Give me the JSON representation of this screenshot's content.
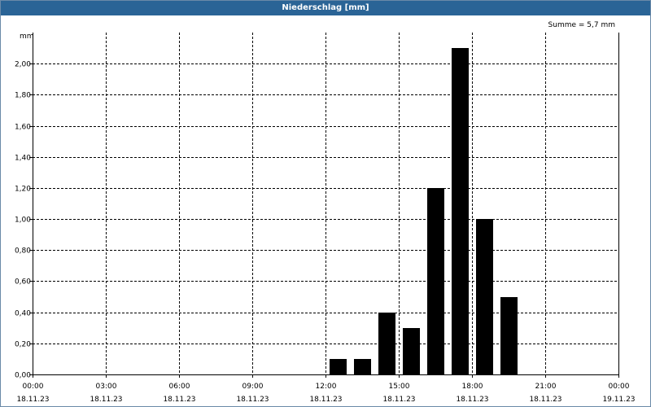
{
  "window": {
    "title": "Niederschlag [mm]",
    "sum_label": "Summe = 5,7 mm"
  },
  "chart_data": {
    "type": "bar",
    "title": "Niederschlag [mm]",
    "ylabel": "mm",
    "annotation": "Summe = 5,7 mm",
    "ylim": [
      0,
      2.2
    ],
    "y_ticks": [
      {
        "value": 0.0,
        "label": "0,00"
      },
      {
        "value": 0.2,
        "label": "0,20"
      },
      {
        "value": 0.4,
        "label": "0,40"
      },
      {
        "value": 0.6,
        "label": "0,60"
      },
      {
        "value": 0.8,
        "label": "0,80"
      },
      {
        "value": 1.0,
        "label": "1,00"
      },
      {
        "value": 1.2,
        "label": "1,20"
      },
      {
        "value": 1.4,
        "label": "1,40"
      },
      {
        "value": 1.6,
        "label": "1,60"
      },
      {
        "value": 1.8,
        "label": "1,80"
      },
      {
        "value": 2.0,
        "label": "2,00"
      }
    ],
    "x_range_hours": [
      0,
      24
    ],
    "x_ticks": [
      {
        "hour": 0,
        "time": "00:00",
        "date": "18.11.23"
      },
      {
        "hour": 3,
        "time": "03:00",
        "date": "18.11.23"
      },
      {
        "hour": 6,
        "time": "06:00",
        "date": "18.11.23"
      },
      {
        "hour": 9,
        "time": "09:00",
        "date": "18.11.23"
      },
      {
        "hour": 12,
        "time": "12:00",
        "date": "18.11.23"
      },
      {
        "hour": 15,
        "time": "15:00",
        "date": "18.11.23"
      },
      {
        "hour": 18,
        "time": "18:00",
        "date": "18.11.23"
      },
      {
        "hour": 21,
        "time": "21:00",
        "date": "18.11.23"
      },
      {
        "hour": 24,
        "time": "00:00",
        "date": "19.11.23"
      }
    ],
    "bar_hour_width": 1,
    "points": [
      {
        "hour": 12,
        "value": 0.1
      },
      {
        "hour": 13,
        "value": 0.1
      },
      {
        "hour": 14,
        "value": 0.4
      },
      {
        "hour": 15,
        "value": 0.3
      },
      {
        "hour": 16,
        "value": 1.2
      },
      {
        "hour": 17,
        "value": 2.1
      },
      {
        "hour": 18,
        "value": 1.0
      },
      {
        "hour": 19,
        "value": 0.5
      }
    ],
    "grid": true,
    "colors": {
      "bars": "#000000",
      "title_bar": "#2a6496",
      "grid": "#000000"
    }
  }
}
